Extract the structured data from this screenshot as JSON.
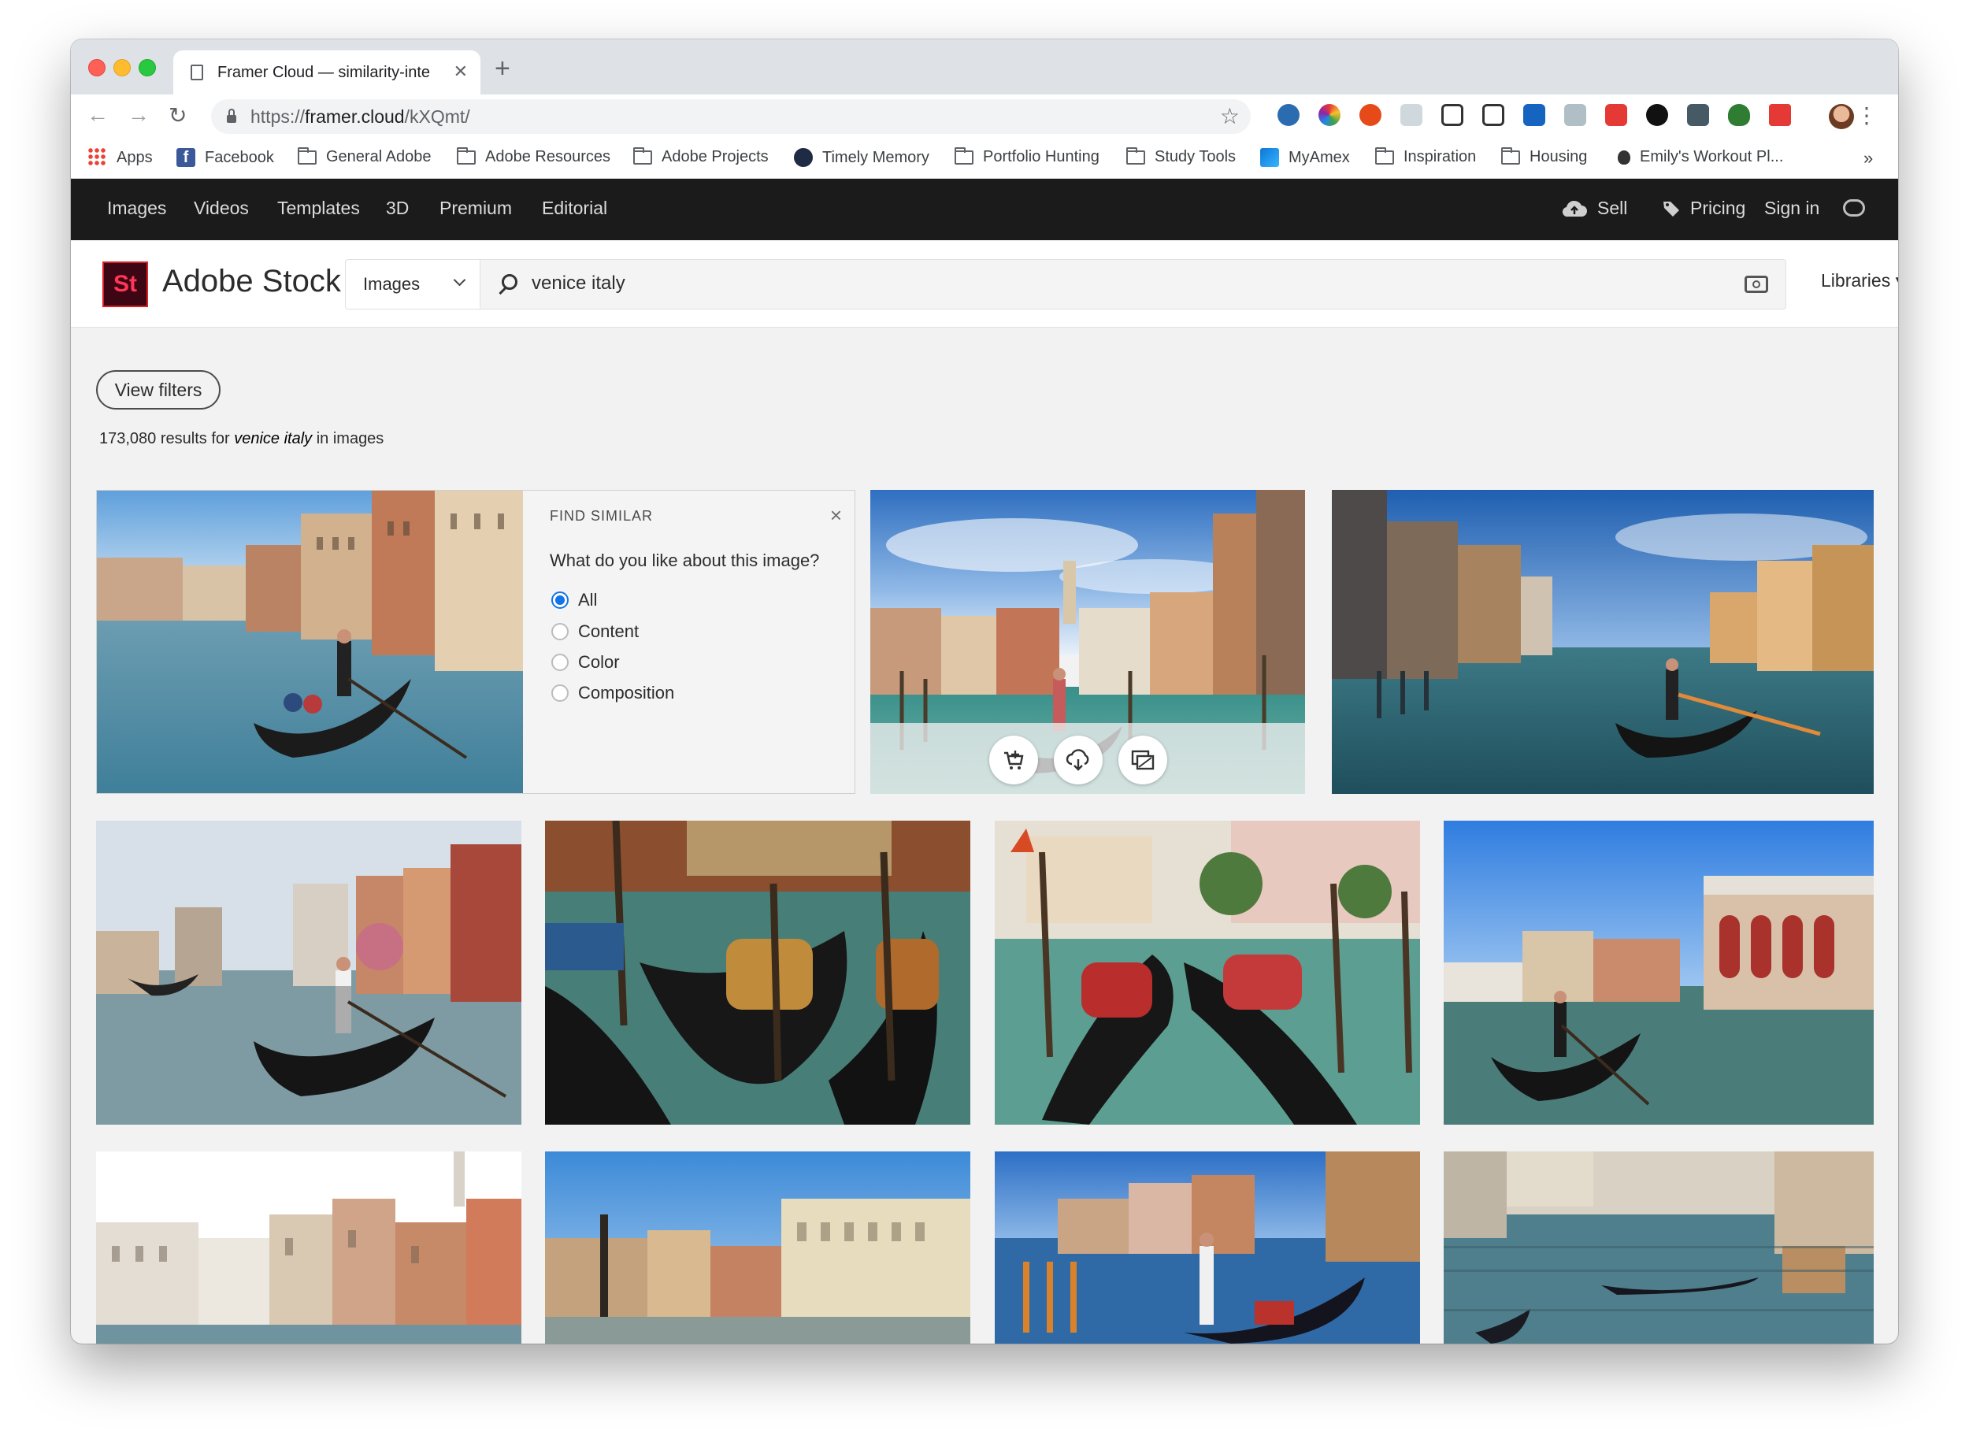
{
  "browser": {
    "tab_title": "Framer Cloud — similarity-inte",
    "url_prefix": "https://",
    "url_host": "framer.cloud",
    "url_path": "/kXQmt/",
    "bookmarks": [
      {
        "label": "Apps",
        "kind": "apps"
      },
      {
        "label": "Facebook",
        "kind": "facebook"
      },
      {
        "label": "General Adobe",
        "kind": "folder"
      },
      {
        "label": "Adobe Resources",
        "kind": "folder"
      },
      {
        "label": "Adobe Projects",
        "kind": "folder"
      },
      {
        "label": "Timely Memory",
        "kind": "timely"
      },
      {
        "label": "Portfolio Hunting",
        "kind": "folder"
      },
      {
        "label": "Study Tools",
        "kind": "folder"
      },
      {
        "label": "MyAmex",
        "kind": "amex"
      },
      {
        "label": "Inspiration",
        "kind": "folder"
      },
      {
        "label": "Housing",
        "kind": "folder"
      },
      {
        "label": "Emily's Workout Pl...",
        "kind": "apple"
      }
    ],
    "more_bookmarks": "»"
  },
  "adobe_nav": {
    "items": [
      "Images",
      "Videos",
      "Templates",
      "3D",
      "Premium",
      "Editorial"
    ],
    "sell": "Sell",
    "pricing": "Pricing",
    "sign_in": "Sign in"
  },
  "header": {
    "logo_text": "St",
    "brand": "Adobe Stock",
    "search_type": "Images",
    "query": "venice italy",
    "libraries": "Libraries"
  },
  "content": {
    "view_filters": "View filters",
    "results_count": "173,080",
    "results_for": " results for ",
    "results_query": "venice italy",
    "results_suffix": " in images"
  },
  "find_similar": {
    "title": "FIND SIMILAR",
    "close": "×",
    "question": "What do you like about this image?",
    "options": [
      "All",
      "Content",
      "Color",
      "Composition"
    ],
    "selected": "All"
  },
  "colors": {
    "accent_blue": "#1473e6",
    "nav_bg": "#1b1b1b",
    "logo_bg": "#3d0614",
    "logo_fg": "#ff3655"
  }
}
